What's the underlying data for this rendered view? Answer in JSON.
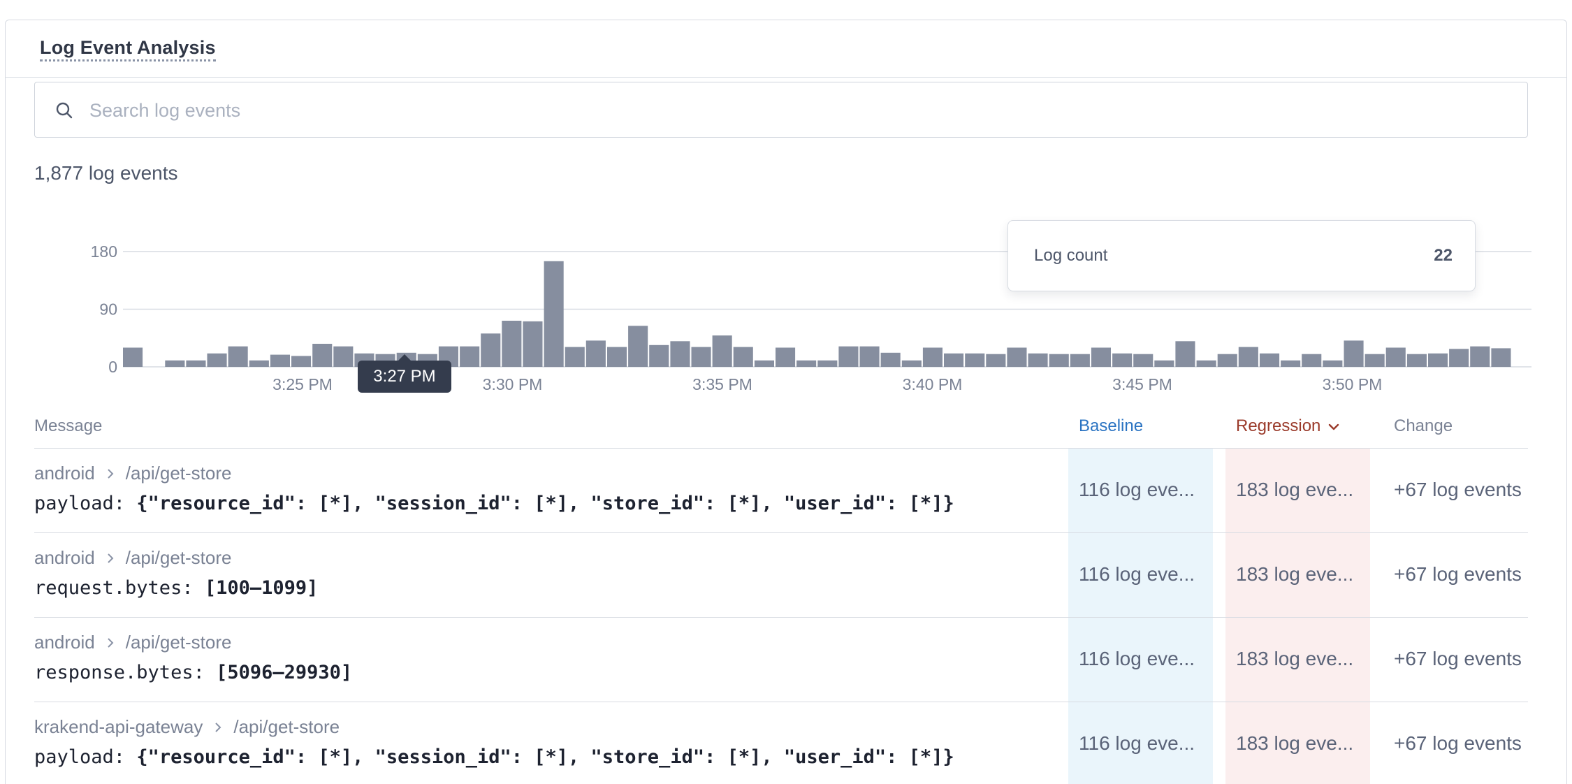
{
  "panel": {
    "title": "Log Event Analysis"
  },
  "search": {
    "placeholder": "Search log events",
    "value": ""
  },
  "summary": {
    "count_text": "1,877 log events"
  },
  "tooltip": {
    "label": "Log count",
    "value": "22"
  },
  "hover_time": "3:27 PM",
  "chart_data": {
    "type": "bar",
    "x_tick_labels": [
      "3:25 PM",
      "3:30 PM",
      "3:35 PM",
      "3:40 PM",
      "3:45 PM",
      "3:50 PM"
    ],
    "y_tick_labels": [
      "180",
      "90",
      "0"
    ],
    "ylim": [
      0,
      180
    ],
    "grid": true,
    "bar_color": "#868e9f",
    "values": [
      30,
      0,
      10,
      10,
      21,
      32,
      10,
      19,
      17,
      36,
      32,
      21,
      20,
      22,
      20,
      32,
      32,
      52,
      72,
      71,
      165,
      31,
      41,
      31,
      64,
      34,
      40,
      31,
      49,
      31,
      10,
      30,
      10,
      10,
      32,
      32,
      22,
      10,
      30,
      21,
      21,
      20,
      30,
      21,
      20,
      20,
      30,
      21,
      20,
      10,
      40,
      10,
      20,
      31,
      21,
      10,
      20,
      10,
      41,
      20,
      30,
      20,
      21,
      28,
      32,
      29
    ]
  },
  "table": {
    "headers": {
      "message": "Message",
      "baseline": "Baseline",
      "regression": "Regression",
      "change": "Change"
    },
    "rows": [
      {
        "source": "android",
        "endpoint": "/api/get-store",
        "key": "payload:",
        "value": "{\"resource_id\": [*], \"session_id\": [*], \"store_id\": [*], \"user_id\": [*]}",
        "baseline": "116 log eve...",
        "regression": "183 log eve...",
        "change": "+67 log events"
      },
      {
        "source": "android",
        "endpoint": "/api/get-store",
        "key": "request.bytes:",
        "value": "[100–1099]",
        "baseline": "116 log eve...",
        "regression": "183 log eve...",
        "change": "+67 log events"
      },
      {
        "source": "android",
        "endpoint": "/api/get-store",
        "key": "response.bytes:",
        "value": "[5096–29930]",
        "baseline": "116 log eve...",
        "regression": "183 log eve...",
        "change": "+67 log events"
      },
      {
        "source": "krakend-api-gateway",
        "endpoint": "/api/get-store",
        "key": "payload:",
        "value": "{\"resource_id\": [*], \"session_id\": [*], \"store_id\": [*], \"user_id\": [*]}",
        "baseline": "116 log eve...",
        "regression": "183 log eve...",
        "change": "+67 log events"
      }
    ]
  },
  "colors": {
    "baseline_accent": "#2a73c2",
    "regression_accent": "#9a3a2a",
    "baseline_bg": "#eaf5fb",
    "regression_bg": "#fbeeee"
  },
  "icons": {
    "search": "search-icon",
    "sort": "chevron-down-icon",
    "breadcrumb": "chevron-right-icon"
  }
}
